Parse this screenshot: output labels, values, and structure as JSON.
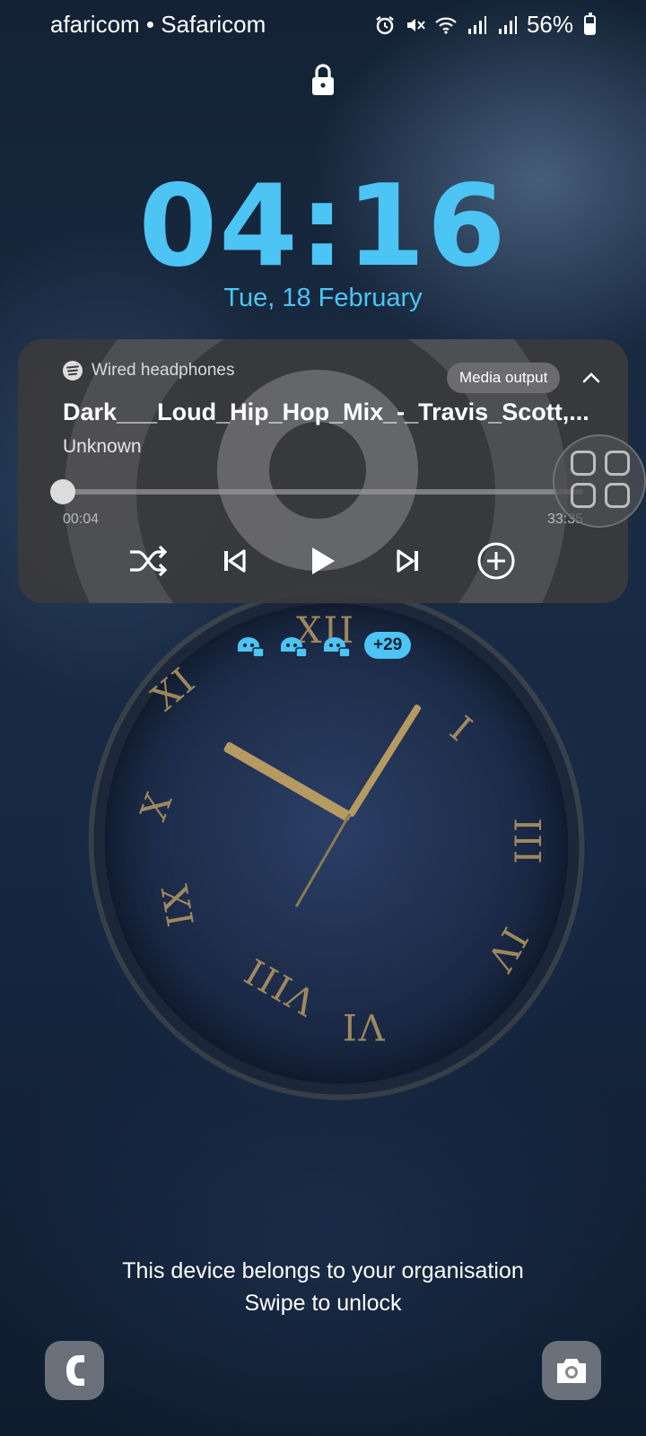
{
  "status_bar": {
    "carrier": "afaricom • Safaricom",
    "battery_percent": "56%",
    "battery_level": 0.56,
    "icons": [
      "alarm-icon",
      "mute-icon",
      "wifi-icon",
      "signal-icon",
      "signal-icon",
      "battery-icon"
    ]
  },
  "lock_screen": {
    "time": "04:16",
    "date": "Tue, 18 February",
    "accent_color": "#4cc4f4"
  },
  "media_player": {
    "source_label": "Wired headphones",
    "source_icon": "spotify-icon",
    "output_button": "Media output",
    "title": "Dark___Loud_Hip_Hop_Mix_-_Travis_Scott,...",
    "artist": "Unknown",
    "elapsed": "00:04",
    "total": "33:35",
    "progress_fraction": 0.002,
    "controls": [
      "shuffle-icon",
      "previous-icon",
      "play-icon",
      "next-icon",
      "add-icon"
    ]
  },
  "notifications": {
    "icons": [
      "app-icon",
      "app-icon",
      "app-icon"
    ],
    "more_count": "+29"
  },
  "footer": {
    "organisation_text": "This device belongs to your organisation",
    "unlock_text": "Swipe to unlock",
    "left_shortcut": "phone-icon",
    "right_shortcut": "camera-icon"
  }
}
